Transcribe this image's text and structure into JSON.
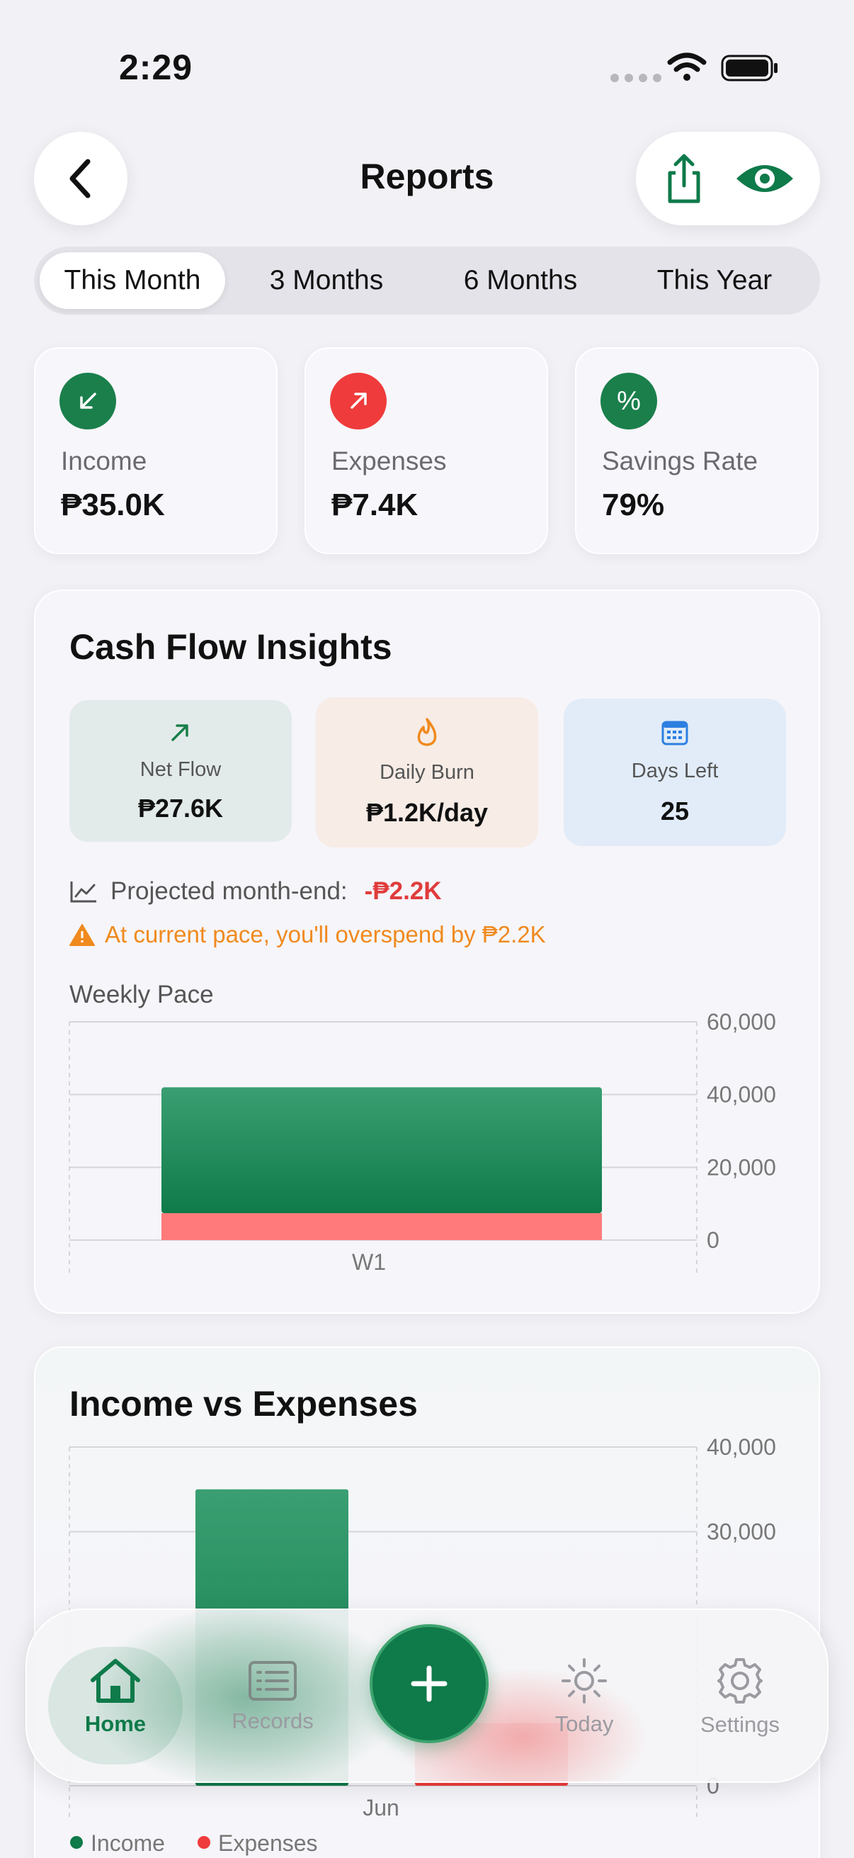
{
  "status_bar": {
    "time": "2:29"
  },
  "header": {
    "title": "Reports",
    "back_icon": "chevron-left-icon",
    "share_icon": "share-icon",
    "eye_icon": "eye-icon"
  },
  "period_tabs": [
    {
      "label": "This Month",
      "active": true
    },
    {
      "label": "3 Months",
      "active": false
    },
    {
      "label": "6 Months",
      "active": false
    },
    {
      "label": "This Year",
      "active": false
    }
  ],
  "summary": [
    {
      "label": "Income",
      "value": "₱35.0K",
      "icon": "arrow-down-left-icon",
      "color": "#1a7f4b"
    },
    {
      "label": "Expenses",
      "value": "₱7.4K",
      "icon": "arrow-up-right-icon",
      "color": "#ef3b3b"
    },
    {
      "label": "Savings Rate",
      "value": "79%",
      "icon": "percent-icon",
      "color": "#1a7f4b"
    }
  ],
  "cash_flow": {
    "title": "Cash Flow Insights",
    "net_flow": {
      "label": "Net Flow",
      "value": "₱27.6K"
    },
    "daily_burn": {
      "label": "Daily Burn",
      "value": "₱1.2K/day"
    },
    "days_left": {
      "label": "Days Left",
      "value": "25"
    },
    "projected_label": "Projected month-end:",
    "projected_value": "-₱2.2K",
    "warning": "At current pace, you'll overspend by ₱2.2K",
    "weekly_pace_label": "Weekly Pace"
  },
  "income_vs_expenses": {
    "title": "Income vs Expenses"
  },
  "chart_data": [
    {
      "type": "bar",
      "title": "Weekly Pace",
      "categories": [
        "W1"
      ],
      "series": [
        {
          "name": "Income",
          "values": [
            42000
          ],
          "color": "#0f7a4a"
        },
        {
          "name": "Expenses",
          "values": [
            7400
          ],
          "color": "#ff7a7a"
        }
      ],
      "stacked": true,
      "y_ticks": [
        "60,000",
        "40,000",
        "20,000",
        "0"
      ],
      "ylim": [
        0,
        60000
      ],
      "grid": true
    },
    {
      "type": "bar",
      "title": "Income vs Expenses",
      "categories": [
        "Jun"
      ],
      "series": [
        {
          "name": "Income",
          "values": [
            35000
          ],
          "color": "#0f7a4a"
        },
        {
          "name": "Expenses",
          "values": [
            7400
          ],
          "color": "#ef3b3b"
        }
      ],
      "y_ticks": [
        "40,000",
        "30,000",
        "0"
      ],
      "ylim": [
        0,
        40000
      ],
      "legend": [
        "Income",
        "Expenses"
      ],
      "grid": true
    }
  ],
  "bottom_nav": {
    "items": [
      {
        "label": "Home",
        "icon": "house-icon",
        "active": true
      },
      {
        "label": "Records",
        "icon": "list-icon",
        "active": false
      },
      {
        "label": "Today",
        "icon": "sun-icon",
        "active": false
      },
      {
        "label": "Settings",
        "icon": "gear-icon",
        "active": false
      }
    ],
    "add_icon": "plus-icon"
  }
}
